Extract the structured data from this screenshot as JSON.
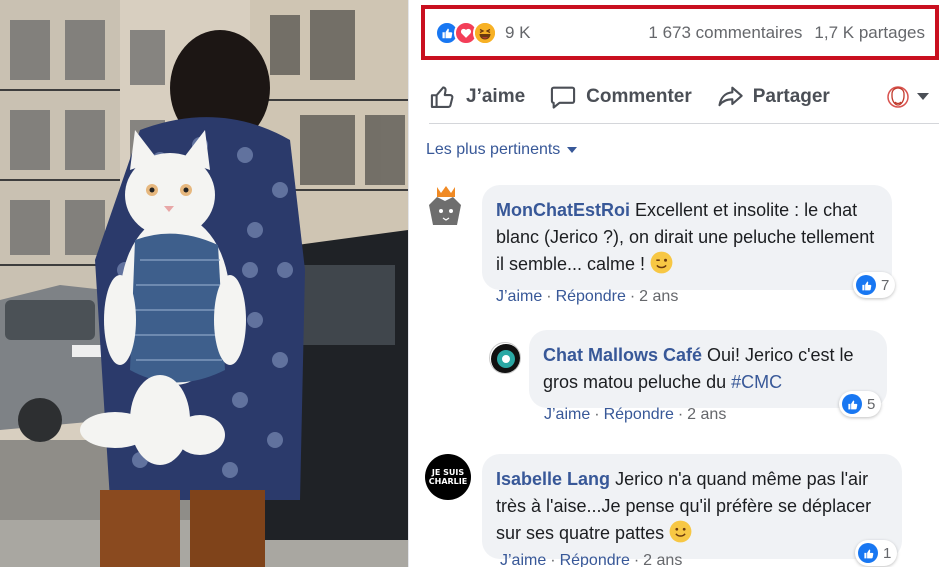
{
  "colors": {
    "frame_highlight": "#c9101f",
    "link": "#385898",
    "like_blue": "#1877f2",
    "love_red": "#f33e58",
    "haha_yellow": "#f7b125",
    "muted": "#65676b",
    "bubble": "#f0f2f5"
  },
  "photo": {
    "icon": "photo-icon"
  },
  "reactions": {
    "icons": [
      "like-reaction-icon",
      "love-reaction-icon",
      "haha-reaction-icon"
    ],
    "count": "9 K",
    "comments": "1 673 commentaires",
    "shares": "1,7 K partages"
  },
  "actions": {
    "like": "J’aime",
    "comment": "Commenter",
    "share": "Partager"
  },
  "sort": {
    "label": "Les plus pertinents"
  },
  "comments": [
    {
      "author": "MonChatEstRoi",
      "text": "Excellent et insolite : le chat blanc (Jerico ?), on dirait une peluche tellement il semble... calme !",
      "emoji": "wink-emoji-icon",
      "like_label": "J’aime",
      "reply_label": "Répondre",
      "time": "2 ans",
      "likes": "7"
    },
    {
      "author": "Chat Mallows Café",
      "text_before": "Oui! Jerico c'est le gros matou peluche du",
      "hashtag": "#CMC",
      "like_label": "J’aime",
      "reply_label": "Répondre",
      "time": "2 ans",
      "likes": "5"
    },
    {
      "author": "Isabelle Lang",
      "text": "Jerico n'a quand même pas l'air très à l'aise...Je pense qu'il préfère se déplacer sur ses quatre pattes",
      "emoji": "smile-emoji-icon",
      "avatar_text": "JE SUIS CHARLIE",
      "like_label": "J’aime",
      "reply_label": "Répondre",
      "time": "2 ans",
      "likes": "1"
    }
  ]
}
